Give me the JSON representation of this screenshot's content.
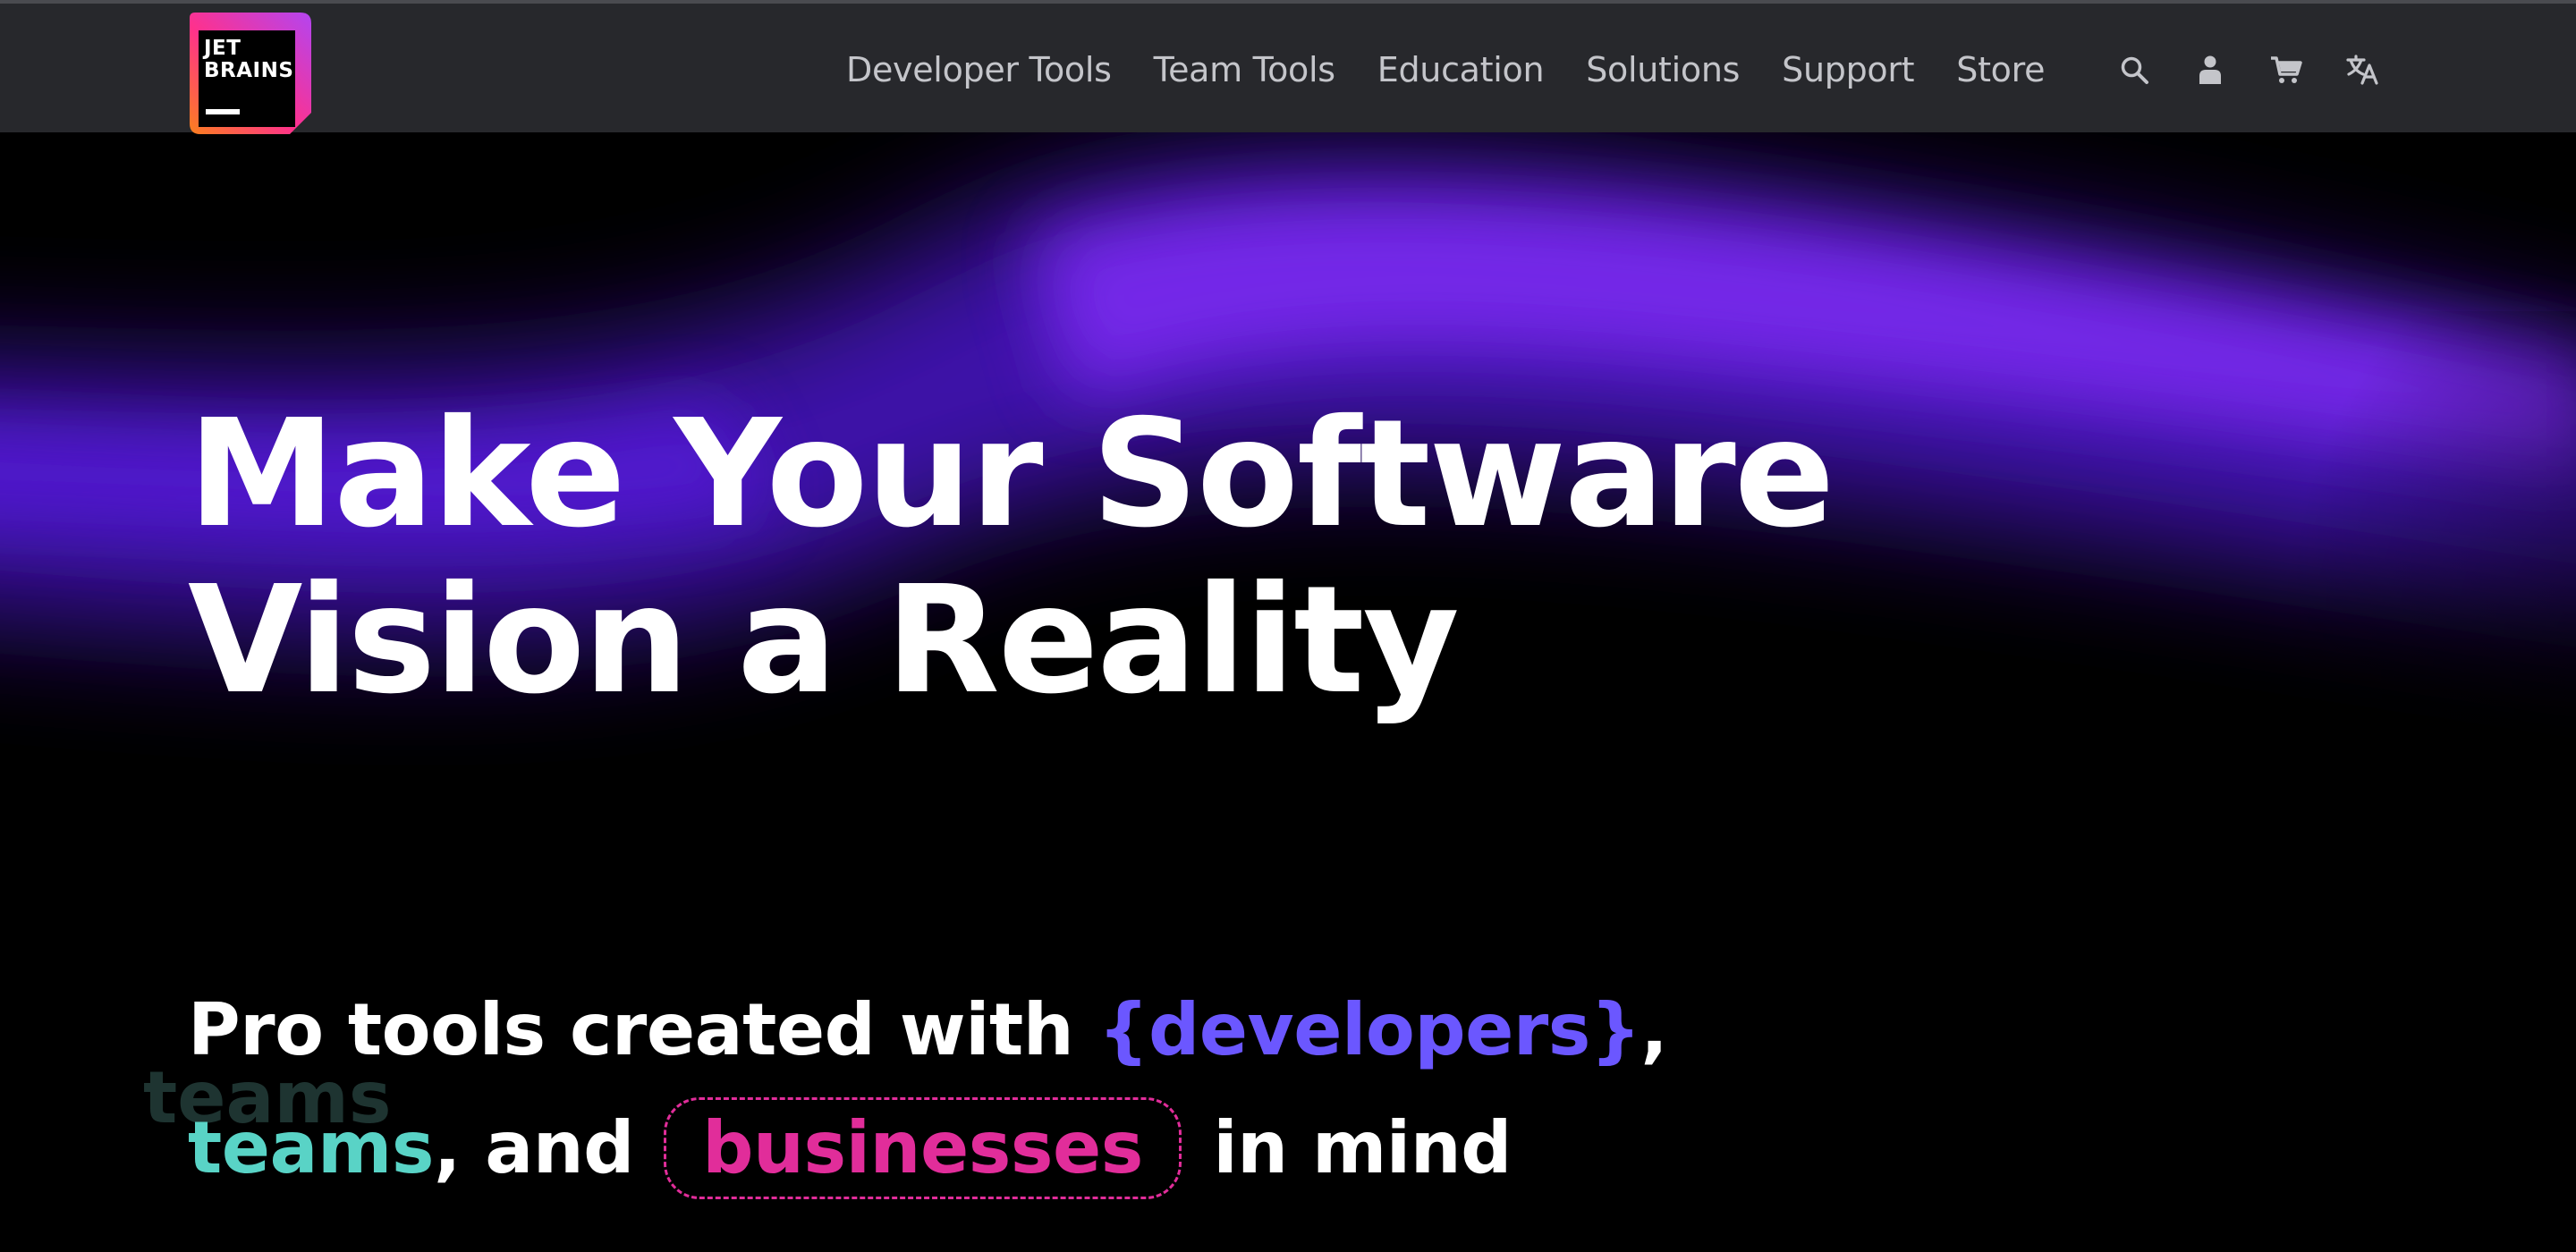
{
  "header": {
    "logo": {
      "wordmark": "JET\nBRAINS",
      "gradient_colors": [
        "#ff318c",
        "#fc801d",
        "#b345f1"
      ]
    },
    "nav": [
      {
        "label": "Developer Tools"
      },
      {
        "label": "Team Tools"
      },
      {
        "label": "Education"
      },
      {
        "label": "Solutions"
      },
      {
        "label": "Support"
      },
      {
        "label": "Store"
      }
    ],
    "icons": [
      "search-icon",
      "user-icon",
      "cart-icon",
      "language-icon"
    ],
    "background": "#27282c"
  },
  "hero": {
    "headline_line1": "Make Your Software",
    "headline_line2": "Vision a Reality",
    "subline": {
      "prefix": "Pro tools created with ",
      "developers": "{developers}",
      "comma": ",",
      "teams": "teams",
      "and": ", and",
      "businesses": "businesses",
      "suffix": "in mind",
      "ghost_text": "teams"
    },
    "colors": {
      "background": "#000000",
      "glow": "#6b22e6",
      "developers": "#6b57ff",
      "teams": "#59d3c6",
      "businesses": "#e12d9a"
    }
  }
}
